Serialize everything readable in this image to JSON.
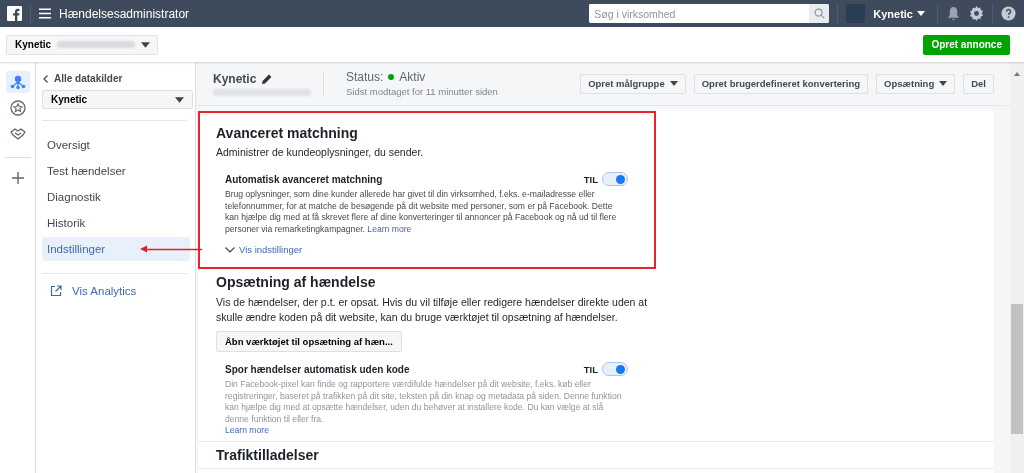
{
  "topbar": {
    "title": "Hændelsesadministrator",
    "search": {
      "placeholder": "Søg i virksomhed"
    },
    "account": {
      "name": "Kynetic"
    }
  },
  "account_bar": {
    "account_name": "Kynetic",
    "create_button": "Opret annonce"
  },
  "rail": [
    {
      "kind": "network",
      "selected": true
    },
    {
      "kind": "star",
      "selected": false
    },
    {
      "kind": "handshake",
      "selected": false
    }
  ],
  "sidebar": {
    "back_link": "Alle datakilder",
    "dropdown": "Kynetic",
    "items": [
      {
        "label": "Oversigt",
        "selected": false
      },
      {
        "label": "Test hændelser",
        "selected": false
      },
      {
        "label": "Diagnostik",
        "selected": false
      },
      {
        "label": "Historik",
        "selected": false
      },
      {
        "label": "Indstillinger",
        "selected": true,
        "annotated": true
      }
    ],
    "external_link": "Vis Analytics"
  },
  "header": {
    "name": "Kynetic",
    "status_label": "Status:",
    "status_value": "Aktiv",
    "last_received": "Sidst modtaget for 11 minutter siden",
    "buttons": [
      {
        "label": "Opret målgruppe",
        "dropdown": true
      },
      {
        "label": "Opret brugerdefineret konvertering",
        "dropdown": false
      },
      {
        "label": "Opsætning",
        "dropdown": true
      },
      {
        "label": "Del",
        "dropdown": false
      }
    ]
  },
  "sections": [
    {
      "title": "Avanceret matchning",
      "description": "Administrer de kundeoplysninger, du sender.",
      "highlighted": true,
      "settings": [
        {
          "title": "Automatisk avanceret matchning",
          "on": true,
          "state_label": "TIL",
          "dimmed": false,
          "description": "Brug oplysninger, som dine kunder allerede har givet til din virksomhed, f.eks. e-mailadresse eller telefonnummer, for at matche de besøgende på dit website med personer, som er på Facebook. Dette kan hjælpe dig med at få skrevet flere af dine konverteringer til annoncer på Facebook og nå ud til flere personer via remarketingkampagner.",
          "link": "Learn more",
          "link_block": false,
          "expander": "Vis indstillinger"
        }
      ]
    },
    {
      "title": "Opsætning af hændelse",
      "description": "Vis de hændelser, der p.t. er opsat. Hvis du vil tilføje eller redigere hændelser direkte uden at skulle ændre koden på dit website, kan du bruge værktøjet til opsætning af hændelser.",
      "highlighted": false,
      "button": "Åbn værktøjet til opsætning af hæn...",
      "settings": [
        {
          "title": "Spor hændelser automatisk uden kode",
          "on": true,
          "state_label": "TIL",
          "dimmed": true,
          "description": "Din Facebook-pixel kan finde og rapportere værdifulde hændelser på dit website, f.eks. køb eller registreringer, baseret på trafikken på dit site, teksten på din knap og metadata på siden. Denne funktion kan hjælpe dig med at opsætte hændelser, uden du behøver at installere kode. Du kan vælge at slå denne funktion til eller fra.",
          "link": "Learn more",
          "link_block": true
        }
      ]
    },
    {
      "title": "Trafiktilladelser",
      "highlighted": false
    }
  ]
}
